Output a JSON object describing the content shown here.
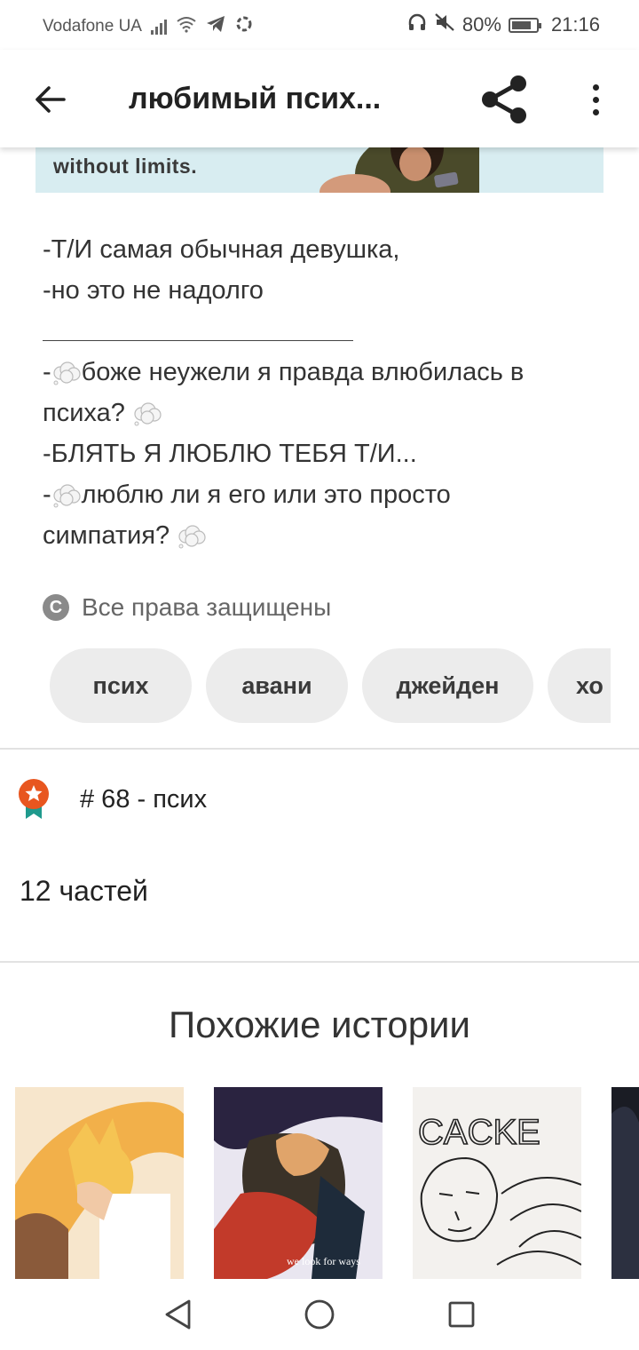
{
  "status_bar": {
    "carrier": "Vodafone UA",
    "battery_percent": "80%",
    "time": "21:16",
    "icons": [
      "signal-icon",
      "wifi-icon",
      "telegram-icon",
      "sync-icon",
      "headphones-icon",
      "mute-icon",
      "battery-icon"
    ],
    "battery_level": 0.8
  },
  "app_bar": {
    "title": "любимый псих...",
    "icons": [
      "back-arrow-icon",
      "share-icon",
      "more-vertical-icon"
    ]
  },
  "ad": {
    "text": "without limits."
  },
  "description": {
    "line1": "-Т/И самая обычная девушка,",
    "line2": "-но это не надолго",
    "line3_prefix": "-",
    "line3_text": "боже неужели я правда влюбилась в",
    "line4": "психа?",
    "line5": "-БЛЯТЬ Я ЛЮБЛЮ ТЕБЯ Т/И...",
    "line6_prefix": "-",
    "line6_text": "люблю ли я его или это просто",
    "line7": "симпатия?"
  },
  "copyright": {
    "icon_glyph": "C",
    "text": "Все права защищены"
  },
  "tags": [
    {
      "label": "псих"
    },
    {
      "label": "авани"
    },
    {
      "label": "джейден"
    },
    {
      "label": "хо"
    }
  ],
  "ranking": {
    "text": "# 68 - псих",
    "icon": "ranking-badge-icon",
    "accent": "#e8561f",
    "ribbon": "#1f9a8d"
  },
  "parts": {
    "text": "12 частей"
  },
  "similar": {
    "title": "Похожие истории",
    "cover_caption": "CACKE",
    "cover2_text": "we look for ways"
  },
  "nav_bar": {
    "icons": [
      "back-triangle-icon",
      "home-circle-icon",
      "recents-square-icon"
    ]
  }
}
